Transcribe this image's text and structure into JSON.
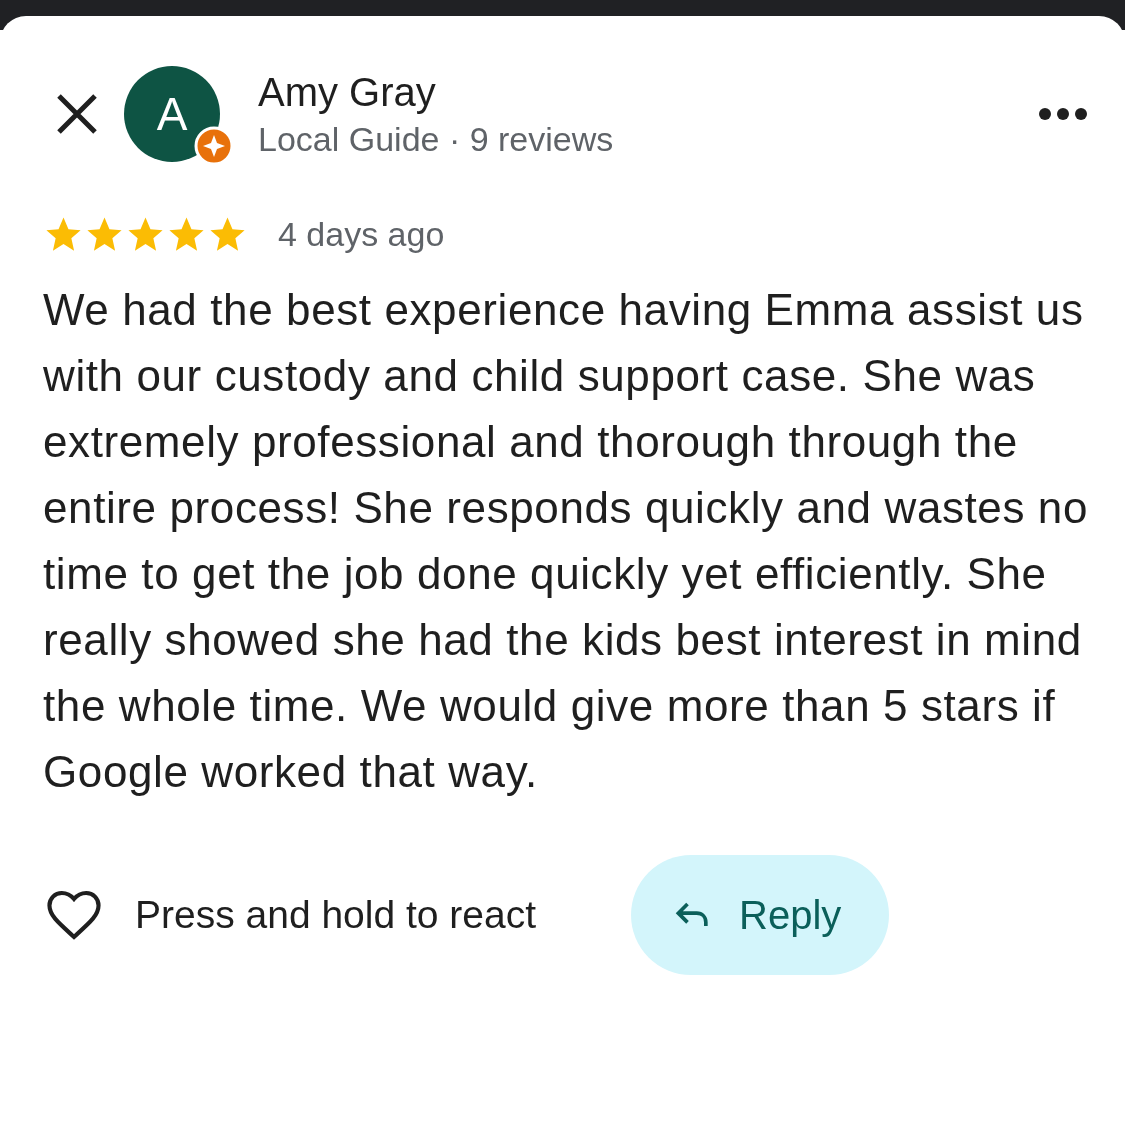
{
  "reviewer": {
    "initial": "A",
    "name": "Amy Gray",
    "details": "Local Guide · 9 reviews",
    "local_guide": true
  },
  "review": {
    "stars": 5,
    "time": "4 days ago",
    "text": "We had the best experience having Emma assist us with our custody and child support case. She was extremely professional and thorough through the entire process! She responds quickly and wastes no time to get the job done quickly yet efficiently. She really showed she had the kids best interest in mind the whole time. We would give more than 5 stars if Google worked that way."
  },
  "actions": {
    "react_label": "Press and hold to react",
    "reply_label": "Reply"
  }
}
